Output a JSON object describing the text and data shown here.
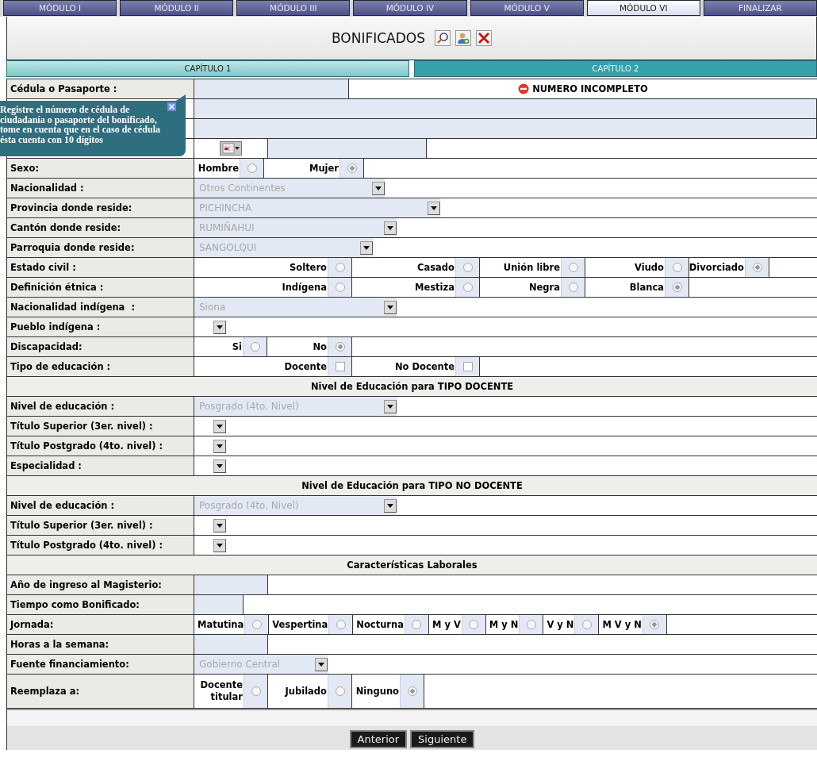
{
  "modules": [
    {
      "label": "MÓDULO I",
      "selected": false
    },
    {
      "label": "MÓDULO II",
      "selected": false
    },
    {
      "label": "MÓDULO III",
      "selected": false
    },
    {
      "label": "MÓDULO IV",
      "selected": false
    },
    {
      "label": "MÓDULO V",
      "selected": false
    },
    {
      "label": "MÓDULO VI",
      "selected": true
    },
    {
      "label": "FINALIZAR",
      "selected": false
    }
  ],
  "title": "BONIFICADOS",
  "chapters": [
    {
      "label": "CAPÍTULO 1",
      "selected": true
    },
    {
      "label": "CAPÍTULO 2",
      "selected": false
    }
  ],
  "rows": [
    {
      "kind": "text",
      "label": "Cédula o Pasaporte :",
      "message": "NUMERO INCOMPLETO"
    },
    {
      "kind": "text"
    },
    {
      "kind": "text"
    },
    {
      "kind": "date"
    },
    {
      "kind": "radios",
      "label": "Sexo:",
      "options": [
        {
          "label": "Hombre",
          "selected": false
        },
        {
          "label": "Mujer",
          "selected": true
        }
      ]
    },
    {
      "kind": "select",
      "label": "Nacionalidad :",
      "value": "Otros Continentes"
    },
    {
      "kind": "select",
      "label": "Provincia donde reside:",
      "value": "PICHINCHA"
    },
    {
      "kind": "select",
      "label": "Cantón donde reside:",
      "value": "RUMIÑAHUI"
    },
    {
      "kind": "select",
      "label": "Parroquia donde reside:",
      "value": "SANGOLQUI"
    },
    {
      "kind": "radios",
      "label": "Estado civil :",
      "options": [
        {
          "label": "Soltero",
          "selected": false
        },
        {
          "label": "Casado",
          "selected": false
        },
        {
          "label": "Unión libre",
          "selected": false
        },
        {
          "label": "Viudo",
          "selected": false
        },
        {
          "label": "Divorciado",
          "selected": true
        }
      ]
    },
    {
      "kind": "radios",
      "label": "Definición étnica :",
      "options": [
        {
          "label": "Indígena",
          "selected": false
        },
        {
          "label": "Mestiza",
          "selected": false
        },
        {
          "label": "Negra",
          "selected": false
        },
        {
          "label": "Blanca",
          "selected": true
        }
      ]
    },
    {
      "kind": "select",
      "label": "Nacionalidad indígena  :",
      "value": "Siona"
    },
    {
      "kind": "select",
      "label": "Pueblo indígena :"
    },
    {
      "kind": "radios",
      "label": "Discapacidad:",
      "options": [
        {
          "label": "Si",
          "selected": false
        },
        {
          "label": "No",
          "selected": true
        }
      ]
    },
    {
      "kind": "checks",
      "label": "Tipo de educación :",
      "options": [
        {
          "label": "Docente",
          "checked": false
        },
        {
          "label": "No Docente",
          "checked": false
        }
      ]
    },
    {
      "kind": "section",
      "title": "Nivel de Educación para TIPO DOCENTE"
    },
    {
      "kind": "select",
      "label": "Nivel de educación :",
      "value": "Posgrado (4to. Nivel)"
    },
    {
      "kind": "select",
      "label": "Título Superior (3er. nivel) :"
    },
    {
      "kind": "select",
      "label": "Título Postgrado (4to. nivel) :"
    },
    {
      "kind": "select",
      "label": "Especialidad :"
    },
    {
      "kind": "section",
      "title": "Nivel de Educación para TIPO NO DOCENTE"
    },
    {
      "kind": "select",
      "label": "Nivel de educación :",
      "value": "Posgrado (4to. Nivel)"
    },
    {
      "kind": "select",
      "label": "Título Superior (3er. nivel) :"
    },
    {
      "kind": "select",
      "label": "Título Postgrado (4to. nivel) :"
    },
    {
      "kind": "section",
      "title": "Características Laborales"
    },
    {
      "kind": "text",
      "label": "Año de ingreso al Magisterio:"
    },
    {
      "kind": "text",
      "label": "Tiempo como Bonificado:"
    },
    {
      "kind": "radios",
      "label": "Jornada:",
      "options": [
        {
          "label": "Matutina",
          "selected": false
        },
        {
          "label": "Vespertina",
          "selected": false
        },
        {
          "label": "Nocturna",
          "selected": false
        },
        {
          "label": "M y V",
          "selected": false
        },
        {
          "label": "M y N",
          "selected": false
        },
        {
          "label": "V y N",
          "selected": false
        },
        {
          "label": "M V y N",
          "selected": true
        }
      ]
    },
    {
      "kind": "text",
      "label": "Horas a la semana:"
    },
    {
      "kind": "select",
      "label": "Fuente financiamiento:",
      "value": "Gobierno Central"
    },
    {
      "kind": "radios",
      "label": "Reemplaza a:",
      "options": [
        {
          "label": "Docente titular",
          "selected": false
        },
        {
          "label": "Jubilado",
          "selected": false
        },
        {
          "label": "Ninguno",
          "selected": true
        }
      ]
    }
  ],
  "tooltip": "Registre el número de cédula de ciudadanía o pasaporte del bonificado, tome en cuenta que en el caso de cédula ésta cuenta con 10 dígitos",
  "buttons": [
    "Anterior",
    "Siguiente"
  ]
}
